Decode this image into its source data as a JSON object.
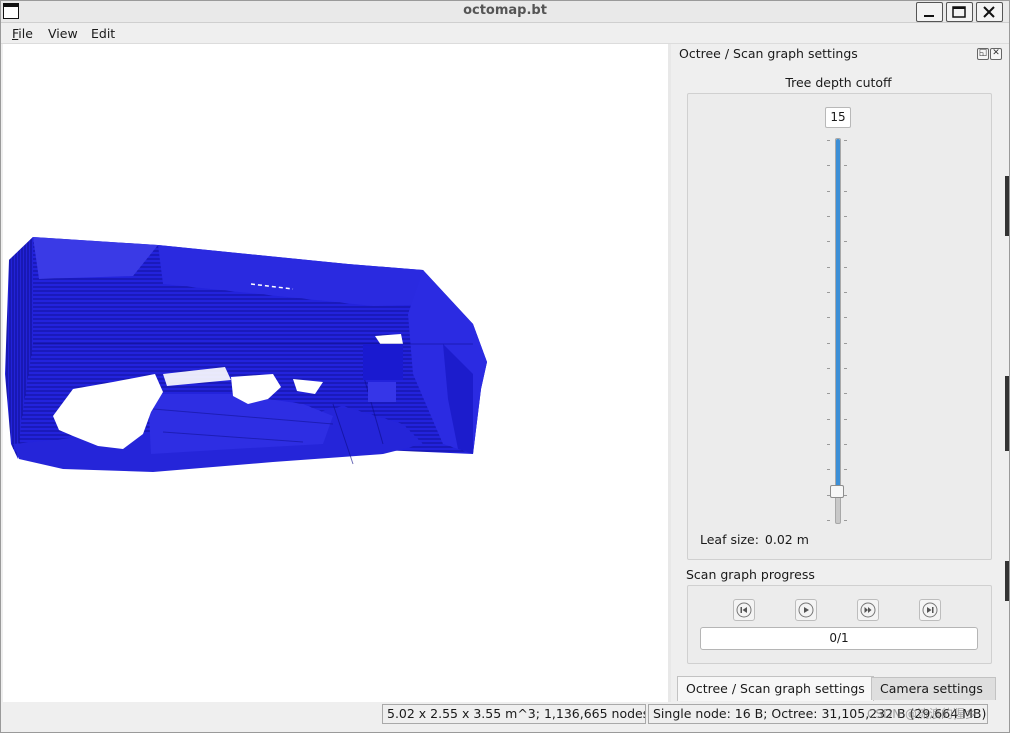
{
  "window": {
    "title": "octomap.bt"
  },
  "menubar": {
    "items": [
      {
        "label": "File",
        "mnemonic": "F",
        "rest": "ile"
      },
      {
        "label": "View"
      },
      {
        "label": "Edit"
      }
    ]
  },
  "viewport": {
    "description_icon": "octomap-voxel-cloud",
    "voxel_color": "#1f1fd6"
  },
  "dock": {
    "title": "Octree / Scan graph settings",
    "float_icon": "float-icon",
    "close_icon": "close-icon",
    "tree_depth": {
      "label": "Tree depth cutoff",
      "value": "15",
      "slider_fraction": 0.92
    },
    "leaf_size": {
      "label": "Leaf size:",
      "value": "0.02 m"
    },
    "scan_graph": {
      "label": "Scan graph progress",
      "buttons": [
        "skip-to-start-icon",
        "play-icon",
        "fast-forward-icon",
        "skip-to-end-icon"
      ],
      "progress_text": "0/1"
    },
    "tabs": [
      {
        "label": "Octree / Scan graph settings",
        "active": true
      },
      {
        "label": "Camera settings",
        "active": false
      }
    ]
  },
  "statusbar": {
    "field1": "5.02 x 2.55 x 3.55 m^3; 1,136,665 nodes",
    "field2": "Single node: 16 B; Octree: 31,105,232 B (29.664 MB)",
    "watermark": "CSDN @流浪的猩乡"
  },
  "colors": {
    "accent": "#3c8fd6",
    "voxel": "#1f1fd6"
  }
}
